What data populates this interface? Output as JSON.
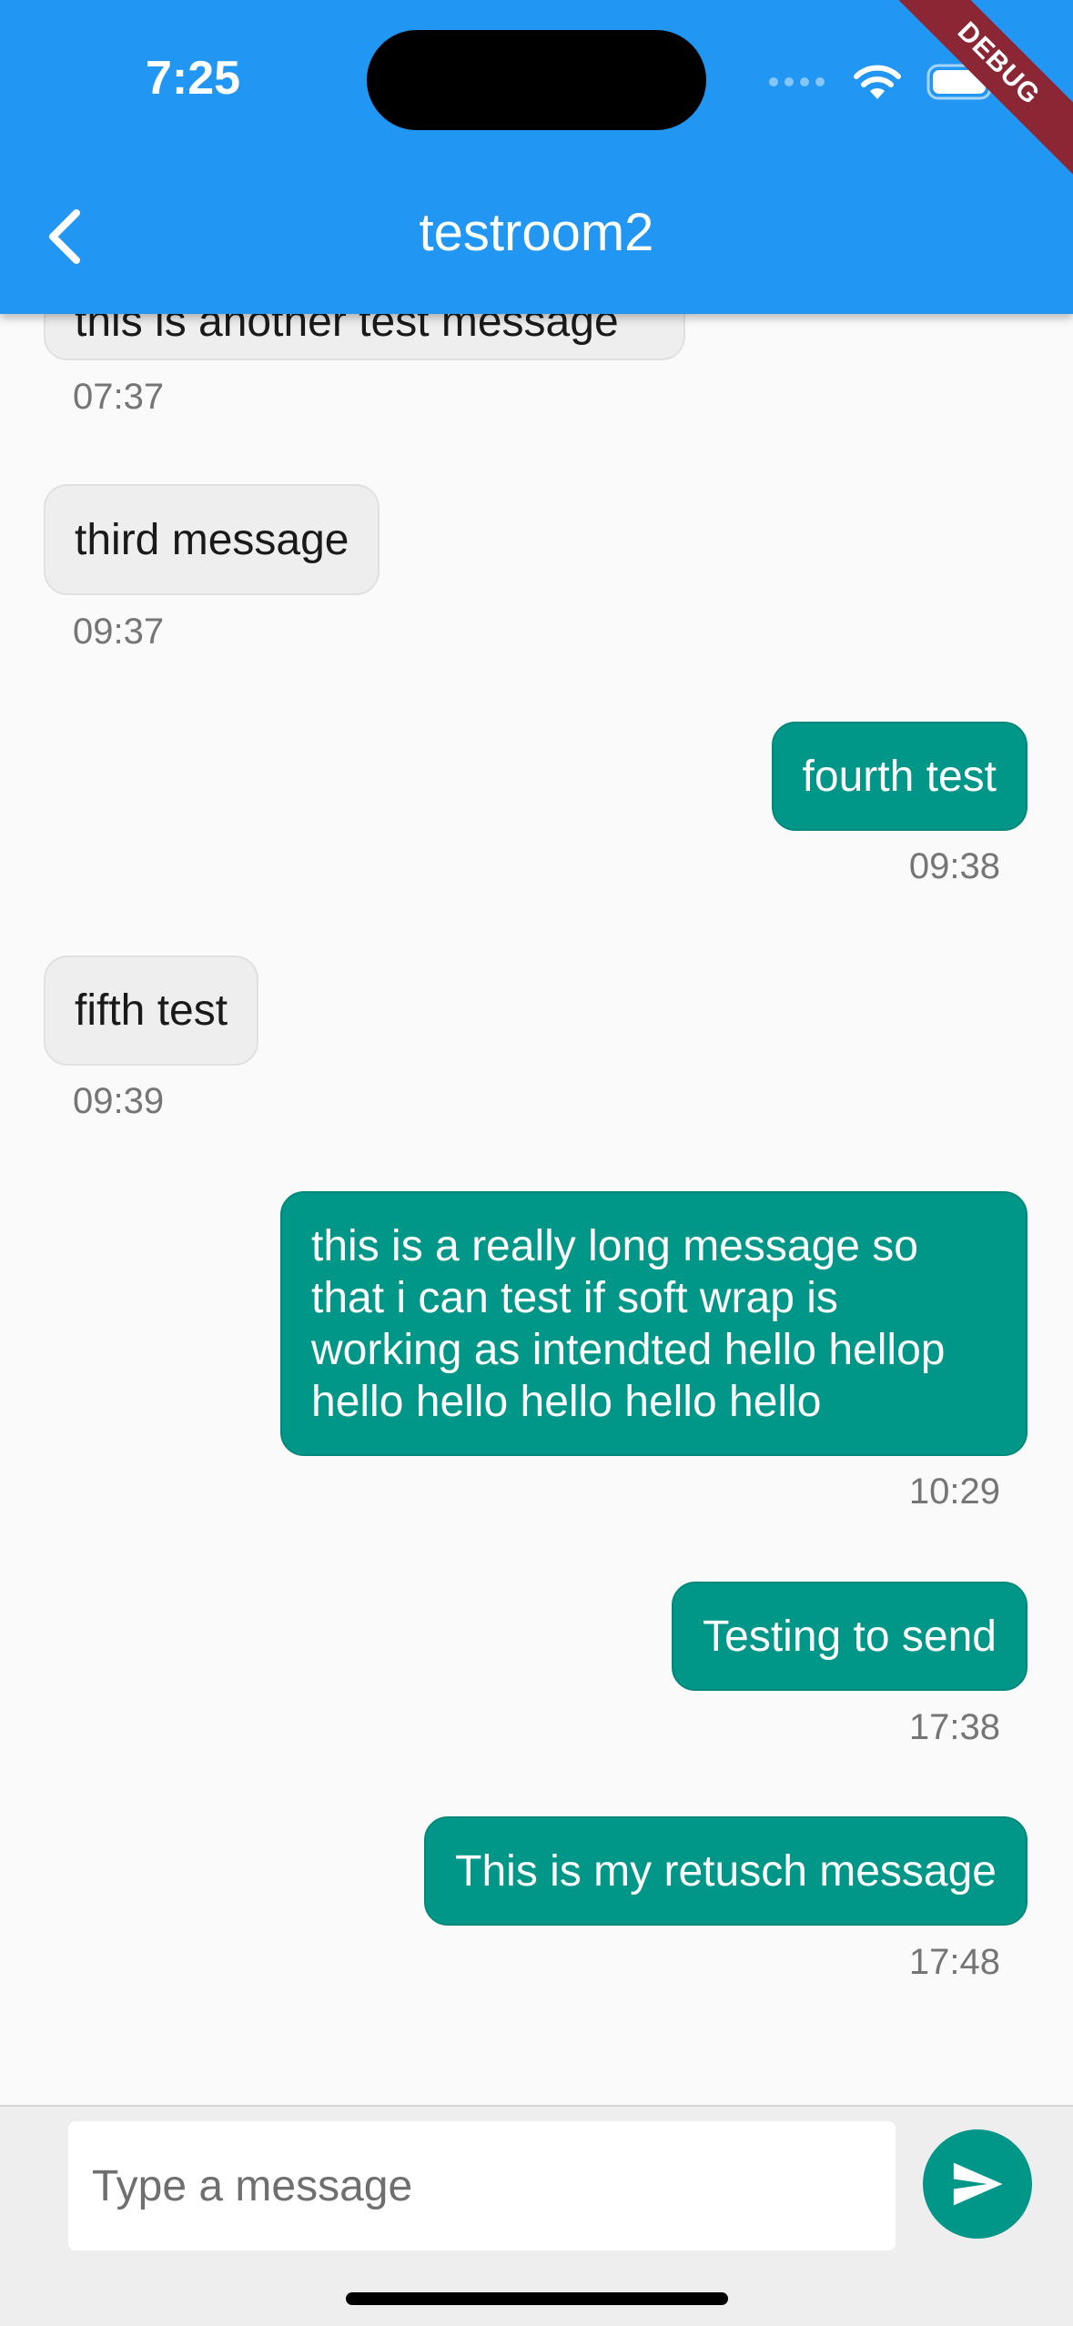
{
  "status_bar": {
    "time": "7:25",
    "debug_label": "DEBUG"
  },
  "app_bar": {
    "title": "testroom2",
    "back_icon": "chevron-left-icon",
    "color": "#2196f3"
  },
  "messages": [
    {
      "text": "this is another test message",
      "time": "07:37",
      "direction": "incoming"
    },
    {
      "text": "third message",
      "time": "09:37",
      "direction": "incoming"
    },
    {
      "text": "fourth test",
      "time": "09:38",
      "direction": "outgoing"
    },
    {
      "text": "fifth test",
      "time": "09:39",
      "direction": "incoming"
    },
    {
      "text": "this is a really long message so that i can test if soft wrap is working as intendted hello hellop hello hello hello hello hello",
      "time": "10:29",
      "direction": "outgoing"
    },
    {
      "text": "Testing to send",
      "time": "17:38",
      "direction": "outgoing"
    },
    {
      "text": "This is my retusch message",
      "time": "17:48",
      "direction": "outgoing"
    }
  ],
  "composer": {
    "placeholder": "Type a message",
    "value": "",
    "send_icon": "send-icon",
    "accent": "#009688"
  },
  "colors": {
    "outgoing_bubble": "#009688",
    "incoming_bubble": "#eeeeee"
  }
}
